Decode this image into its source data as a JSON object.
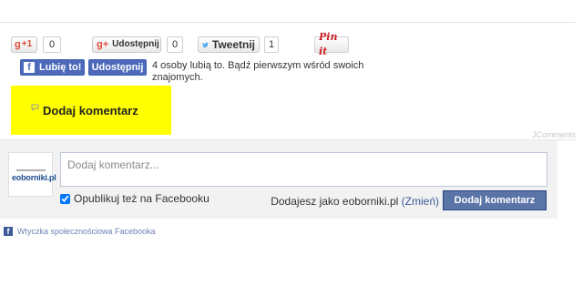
{
  "share": {
    "gplus_one": {
      "g_label": "g",
      "plus_label": "+1",
      "count": "0"
    },
    "google_share": {
      "icon_label": "g+",
      "label": "Udostępnij",
      "count": "0"
    },
    "tweet": {
      "label": "Tweetnij",
      "count": "1"
    },
    "pinterest": {
      "label": "Pin it"
    }
  },
  "facebook": {
    "like_label": "Lubię to!",
    "share_label": "Udostępnij",
    "social_text": "4 osoby lubią to. Bądź pierwszym wśród swoich znajomych."
  },
  "add_comment": {
    "label": "Dodaj komentarz"
  },
  "jcomments_label": "JComments",
  "fb_comments": {
    "avatar_logo": "eoborniki.pl",
    "input_placeholder": "Dodaj komentarz...",
    "publish_label": "Opublikuj też na Facebooku",
    "posting_as_prefix": "Dodajesz jako eoborniki.pl",
    "change_label": "(Zmień)",
    "submit_label": "Dodaj komentarz"
  },
  "footer": {
    "plugin_label": "Wtyczka społecznościowa Facebooka"
  },
  "colors": {
    "facebook_blue": "#4c69ba",
    "highlight_yellow": "#ffff00",
    "google_red": "#dd4b39",
    "twitter_blue": "#55acee",
    "pinterest_red": "#cb2027"
  }
}
